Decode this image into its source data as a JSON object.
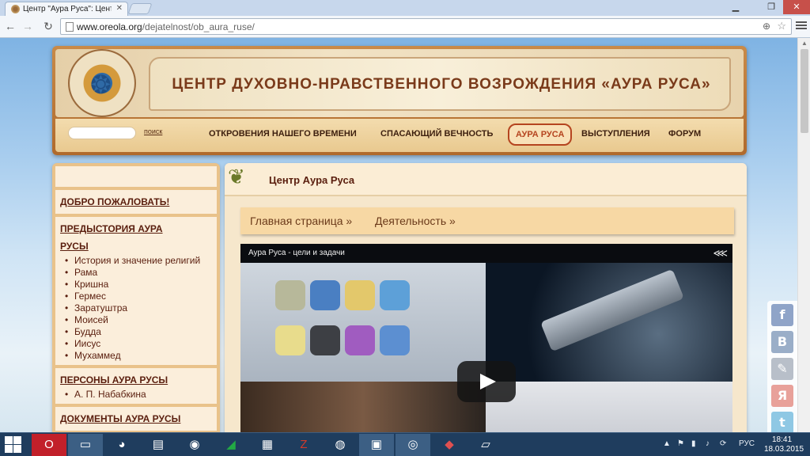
{
  "browser": {
    "tab_title": "Центр \"Аура Руса\": Центр",
    "url_domain": "www.oreola.org",
    "url_path": "/dejatelnost/ob_aura_ruse/"
  },
  "header": {
    "banner_title": "ЦЕНТР ДУХОВНО-НРАВСТВЕННОГО ВОЗРОЖДЕНИЯ «АУРА РУСА»",
    "search_label": "поиск",
    "nav": [
      {
        "label": "ОТКРОВЕНИЯ НАШЕГО ВРЕМЕНИ"
      },
      {
        "label": "СПАСАЮЩИЙ ВЕЧНОСТЬ"
      },
      {
        "label": "АУРА РУСА",
        "active": true
      },
      {
        "label": "ВЫСТУПЛЕНИЯ"
      },
      {
        "label": "ФОРУМ"
      }
    ]
  },
  "sidebar": {
    "welcome": "ДОБРО ПОЖАЛОВАТЬ!",
    "prehistory_title_1": "ПРЕДЫСТОРИЯ АУРА",
    "prehistory_title_2": "РУСЫ",
    "prehistory_items": [
      "История и значение религий",
      "Рама",
      "Кришна",
      "Гермес",
      "Заратуштра",
      "Моисей",
      "Будда",
      "Иисус",
      "Мухаммед"
    ],
    "persons_title": "ПЕРСОНЫ АУРА РУСЫ",
    "persons_items": [
      "А. П. Набабкина"
    ],
    "documents_title": "ДОКУМЕНТЫ АУРА РУСЫ"
  },
  "main": {
    "title": "Центр Аура Руса",
    "breadcrumb_home": "Главная страница »",
    "breadcrumb_current": "Деятельность »",
    "video_title": "Аура Руса - цели и задачи"
  },
  "share": {
    "buttons": [
      {
        "icon": "facebook-icon",
        "glyph": "f",
        "color": "#8fa4c8"
      },
      {
        "icon": "vkontakte-icon",
        "glyph": "B",
        "color": "#9aaec8"
      },
      {
        "icon": "livejournal-icon",
        "glyph": "✎",
        "color": "#b8bfc9"
      },
      {
        "icon": "yandex-icon",
        "glyph": "Я",
        "color": "#e8a19a"
      },
      {
        "icon": "twitter-icon",
        "glyph": "t",
        "color": "#8fc8e4"
      }
    ]
  },
  "taskbar": {
    "language": "РУС",
    "time": "18:41",
    "date": "18.03.2015"
  }
}
